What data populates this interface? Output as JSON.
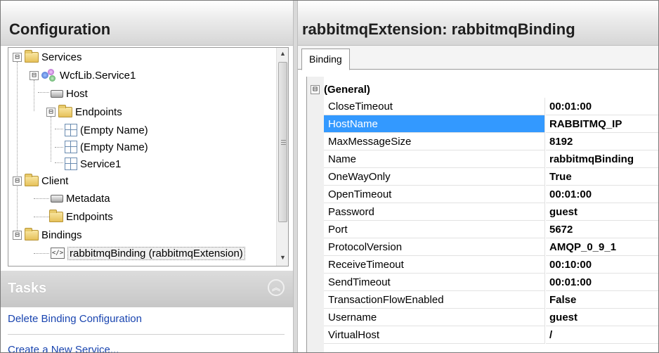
{
  "left_pane": {
    "title": "Configuration",
    "tree": {
      "items": [
        {
          "label": "Services",
          "expander": "⊟"
        },
        {
          "label": "WcfLib.Service1",
          "expander": "⊟"
        },
        {
          "label": "Host"
        },
        {
          "label": "Endpoints",
          "expander": "⊟"
        },
        {
          "label": "(Empty Name)"
        },
        {
          "label": "(Empty Name)"
        },
        {
          "label": "Service1"
        },
        {
          "label": "Client",
          "expander": "⊟"
        },
        {
          "label": "Metadata"
        },
        {
          "label": "Endpoints"
        },
        {
          "label": "Bindings",
          "expander": "⊟"
        },
        {
          "label": "rabbitmqBinding (rabbitmqExtension)",
          "selected": true
        }
      ]
    },
    "tasks": {
      "title": "Tasks",
      "links": [
        "Delete Binding Configuration",
        "Create a New Service..."
      ]
    }
  },
  "right_pane": {
    "title": "rabbitmqExtension: rabbitmqBinding",
    "tabs": [
      "Binding"
    ],
    "category": {
      "label": "(General)",
      "expander": "⊟"
    },
    "properties": [
      {
        "name": "CloseTimeout",
        "value": "00:01:00"
      },
      {
        "name": "HostName",
        "value": "RABBITMQ_IP",
        "selected": true
      },
      {
        "name": "MaxMessageSize",
        "value": "8192"
      },
      {
        "name": "Name",
        "value": "rabbitmqBinding"
      },
      {
        "name": "OneWayOnly",
        "value": "True"
      },
      {
        "name": "OpenTimeout",
        "value": "00:01:00"
      },
      {
        "name": "Password",
        "value": "guest"
      },
      {
        "name": "Port",
        "value": "5672"
      },
      {
        "name": "ProtocolVersion",
        "value": "AMQP_0_9_1"
      },
      {
        "name": "ReceiveTimeout",
        "value": "00:10:00"
      },
      {
        "name": "SendTimeout",
        "value": "00:01:00"
      },
      {
        "name": "TransactionFlowEnabled",
        "value": "False"
      },
      {
        "name": "Username",
        "value": "guest"
      },
      {
        "name": "VirtualHost",
        "value": "/"
      }
    ]
  },
  "colors": {
    "selection": "#3399ff",
    "link": "#1a45b0",
    "header_gradient_bottom": "#d6d6d6"
  },
  "icons": {
    "tree_expander": "⊟",
    "scroll_up": "▲",
    "scroll_down": "▼",
    "tasks_collapse": "︽"
  }
}
